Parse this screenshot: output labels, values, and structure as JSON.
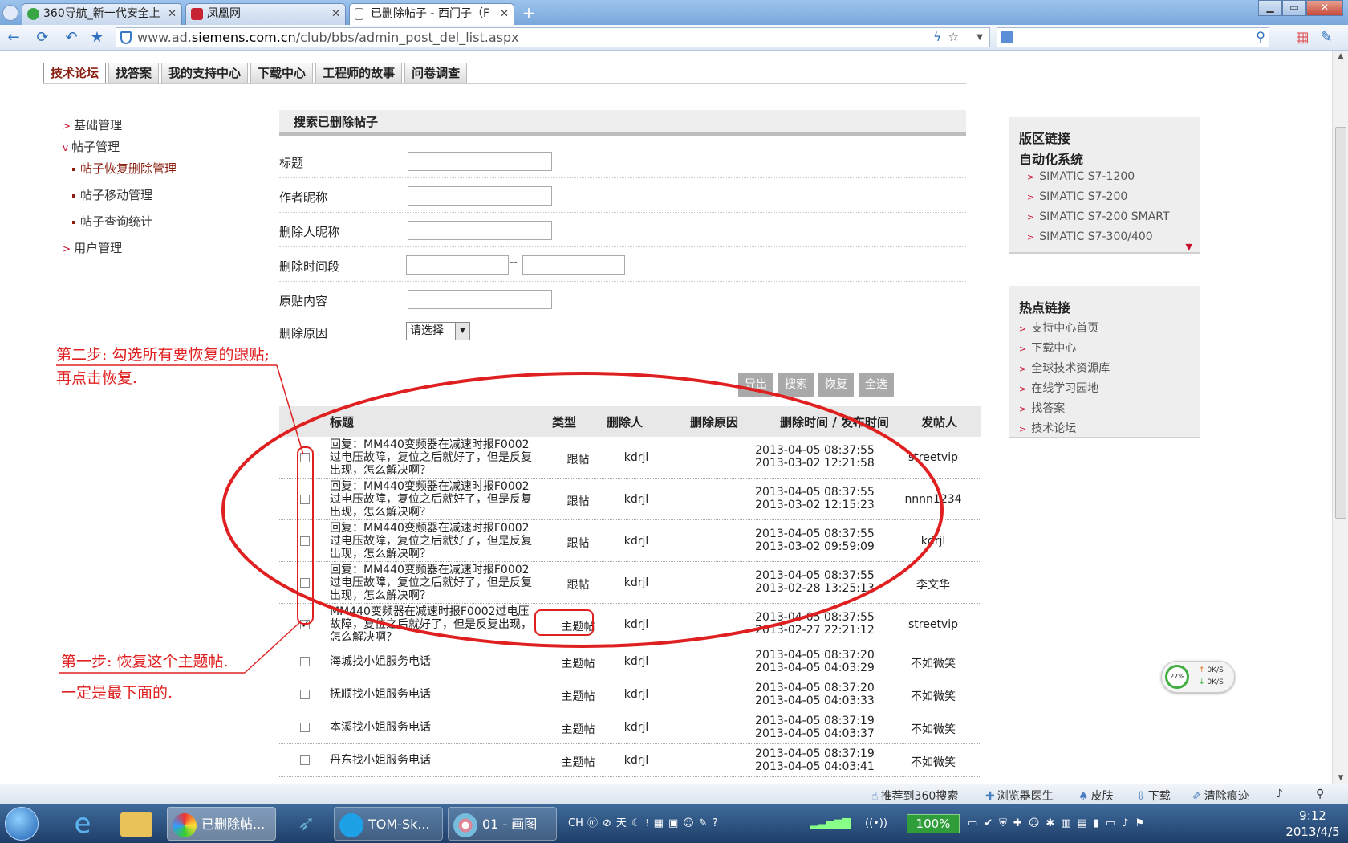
{
  "browser": {
    "tabs": [
      {
        "title": "360导航_新一代安全上",
        "color": "#39a545"
      },
      {
        "title": "凤凰网",
        "color": "#c82333"
      },
      {
        "title": "已删除帖子 - 西门子（F",
        "color": "#ffffff"
      }
    ],
    "url_prefix": "www.ad.",
    "url_host": "siemens.com.cn",
    "url_path": "/club/bbs/admin_post_del_list.aspx"
  },
  "site_tabs": [
    "技术论坛",
    "找答案",
    "我的支持中心",
    "下载中心",
    "工程师的故事",
    "问卷调查"
  ],
  "left_nav": {
    "basic": "基础管理",
    "post_mgmt": "帖子管理",
    "restore": "帖子恢复删除管理",
    "move": "帖子移动管理",
    "stats": "帖子查询统计",
    "users": "用户管理"
  },
  "search_panel": {
    "header": "搜索已删除帖子",
    "fields": {
      "title": "标题",
      "author": "作者昵称",
      "deleter": "删除人昵称",
      "period": "删除时间段",
      "period_sep": "--",
      "content": "原贴内容",
      "reason": "删除原因",
      "reason_select": "请选择"
    },
    "buttons": [
      "导出",
      "搜索",
      "恢复",
      "全选"
    ]
  },
  "table": {
    "headers": [
      "标题",
      "类型",
      "删除人",
      "删除原因",
      "删除时间 / 发布时间",
      "发帖人"
    ],
    "rows": [
      {
        "title": "回复：MM440变频器在减速时报F0002过电压故障，复位之后就好了，但是反复出现，怎么解决啊？",
        "type": "跟帖",
        "deleter": "kdrjl",
        "deleted": "2013-04-05 08:37:55",
        "posted": "2013-03-02 12:21:58",
        "author": "streetvip",
        "checked": false
      },
      {
        "title": "回复：MM440变频器在减速时报F0002过电压故障，复位之后就好了，但是反复出现，怎么解决啊？",
        "type": "跟帖",
        "deleter": "kdrjl",
        "deleted": "2013-04-05 08:37:55",
        "posted": "2013-03-02 12:15:23",
        "author": "nnnn1234",
        "checked": false
      },
      {
        "title": "回复：MM440变频器在减速时报F0002过电压故障，复位之后就好了，但是反复出现，怎么解决啊？",
        "type": "跟帖",
        "deleter": "kdrjl",
        "deleted": "2013-04-05 08:37:55",
        "posted": "2013-03-02 09:59:09",
        "author": "kdrjl",
        "checked": false
      },
      {
        "title": "回复：MM440变频器在减速时报F0002过电压故障，复位之后就好了，但是反复出现，怎么解决啊？",
        "type": "跟帖",
        "deleter": "kdrjl",
        "deleted": "2013-04-05 08:37:55",
        "posted": "2013-02-28 13:25:13",
        "author": "李文华",
        "checked": false
      },
      {
        "title": "MM440变频器在减速时报F0002过电压故障，复位之后就好了，但是反复出现，怎么解决啊？",
        "type": "主题帖",
        "deleter": "kdrjl",
        "deleted": "2013-04-05 08:37:55",
        "posted": "2013-02-27 22:21:12",
        "author": "streetvip",
        "checked": true
      },
      {
        "title": "海城找小姐服务电话",
        "type": "主题帖",
        "deleter": "kdrjl",
        "deleted": "2013-04-05 08:37:20",
        "posted": "2013-04-05 04:03:29",
        "author": "不如微笑",
        "checked": false
      },
      {
        "title": "抚顺找小姐服务电话",
        "type": "主题帖",
        "deleter": "kdrjl",
        "deleted": "2013-04-05 08:37:20",
        "posted": "2013-04-05 04:03:33",
        "author": "不如微笑",
        "checked": false
      },
      {
        "title": "本溪找小姐服务电话",
        "type": "主题帖",
        "deleter": "kdrjl",
        "deleted": "2013-04-05 08:37:19",
        "posted": "2013-04-05 04:03:37",
        "author": "不如微笑",
        "checked": false
      },
      {
        "title": "丹东找小姐服务电话",
        "type": "主题帖",
        "deleter": "kdrjl",
        "deleted": "2013-04-05 08:37:19",
        "posted": "2013-04-05 04:03:41",
        "author": "不如微笑",
        "checked": false
      }
    ]
  },
  "annotations": {
    "step2_line1": "第二步: 勾选所有要恢复的跟贴;",
    "step2_line2": "再点击恢复.",
    "step1_line1": "第一步: 恢复这个主题帖.",
    "step1_line2": "一定是最下面的.",
    "color": "#e02020"
  },
  "right": {
    "links_title": "版区链接",
    "automation_title": "自动化系统",
    "automation_links": [
      "SIMATIC S7-1200",
      "SIMATIC S7-200",
      "SIMATIC S7-200 SMART",
      "SIMATIC S7-300/400"
    ],
    "hot_title": "热点链接",
    "hot_links": [
      "支持中心首页",
      "下载中心",
      "全球技术资源库",
      "在线学习园地",
      "找答案",
      "技术论坛"
    ]
  },
  "netmon": {
    "percent": "27%",
    "up": "0K/S",
    "down": "0K/S"
  },
  "statusbar": [
    "推荐到360搜索",
    "浏览器医生",
    "皮肤",
    "下载",
    "清除痕迹"
  ],
  "taskbar": {
    "apps": [
      "已删除帖...",
      "TOM-Sk...",
      "01 - 画图"
    ],
    "lang": "CH",
    "battery": "100%",
    "time": "9:12",
    "date": "2013/4/5"
  },
  "colors": {
    "accent": "#8a1f11",
    "link_chevron": "#c8102e",
    "annotation": "#e02020"
  }
}
